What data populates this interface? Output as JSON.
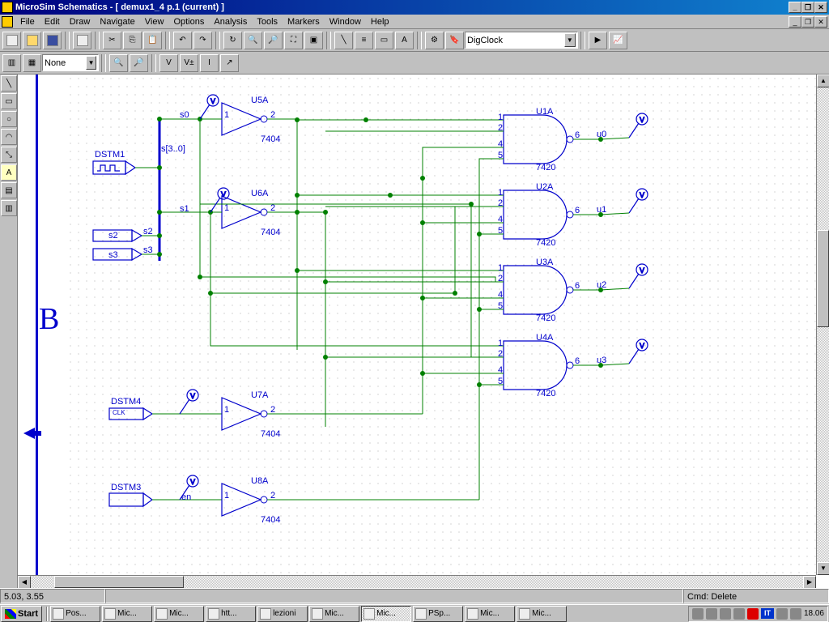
{
  "title": "MicroSim Schematics - [ demux1_4  p.1 (current)  ]",
  "menus": [
    "File",
    "Edit",
    "Draw",
    "Navigate",
    "View",
    "Options",
    "Analysis",
    "Tools",
    "Markers",
    "Window",
    "Help"
  ],
  "toolbar1": {
    "part_combo": "DigClock"
  },
  "toolbar2": {
    "zoom_combo": "None"
  },
  "canvas_corner": "B",
  "labels": {
    "dstm1": "DSTM1",
    "dstm4": "DSTM4",
    "dstm3": "DSTM3",
    "clk": "CLK",
    "en": "en",
    "s0": "s0",
    "s1": "s1",
    "s2": "s2",
    "s3": "s3",
    "sbus": "s[3..0]",
    "u0": "u0",
    "u1": "u1",
    "u2": "u2",
    "u3": "u3",
    "u1a": "U1A",
    "u2a": "U2A",
    "u3a": "U3A",
    "u4a": "U4A",
    "u5a": "U5A",
    "u6a": "U6A",
    "u7a": "U7A",
    "u8a": "U8A",
    "p7404": "7404",
    "p7420": "7420",
    "pin1": "1",
    "pin2": "2",
    "pin4": "4",
    "pin5": "5",
    "pin6": "6"
  },
  "status": {
    "coords": "5.03, 3.55",
    "cmd": "Cmd: Delete"
  },
  "taskbar": {
    "start": "Start",
    "tasks": [
      {
        "label": "Pos...",
        "active": false
      },
      {
        "label": "Mic...",
        "active": false
      },
      {
        "label": "Mic...",
        "active": false
      },
      {
        "label": "htt...",
        "active": false
      },
      {
        "label": "lezioni",
        "active": false
      },
      {
        "label": "Mic...",
        "active": false
      },
      {
        "label": "Mic...",
        "active": true
      },
      {
        "label": "PSp...",
        "active": false
      },
      {
        "label": "Mic...",
        "active": false
      },
      {
        "label": "Mic...",
        "active": false
      }
    ],
    "lang": "IT",
    "clock": "18.06"
  }
}
